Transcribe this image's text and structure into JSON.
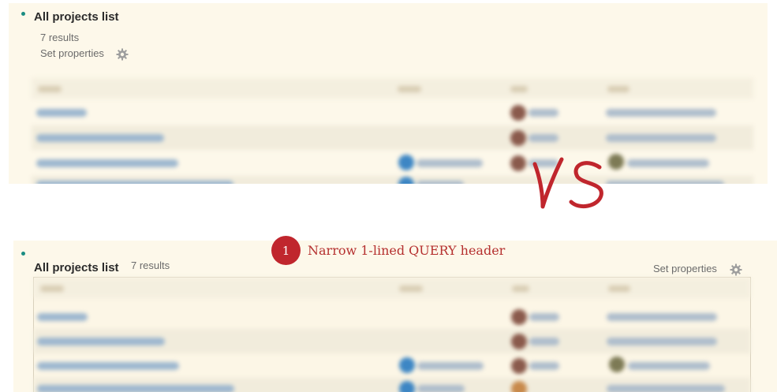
{
  "top_panel": {
    "title": "All projects list",
    "result_count": "7 results",
    "set_properties": "Set properties"
  },
  "bottom_panel": {
    "title": "All projects list",
    "result_count": "7 results",
    "set_properties": "Set properties"
  },
  "annotation": {
    "comparison_mark": "VS",
    "callout_number": "1",
    "callout_text": "Narrow 1-lined QUERY header"
  },
  "colors": {
    "panel_background": "#fdf8ea",
    "bullet": "#1a8c82",
    "annotation_red": "#c0262d"
  },
  "icons": [
    "gear-icon",
    "page-icon",
    "avatar-icon"
  ]
}
